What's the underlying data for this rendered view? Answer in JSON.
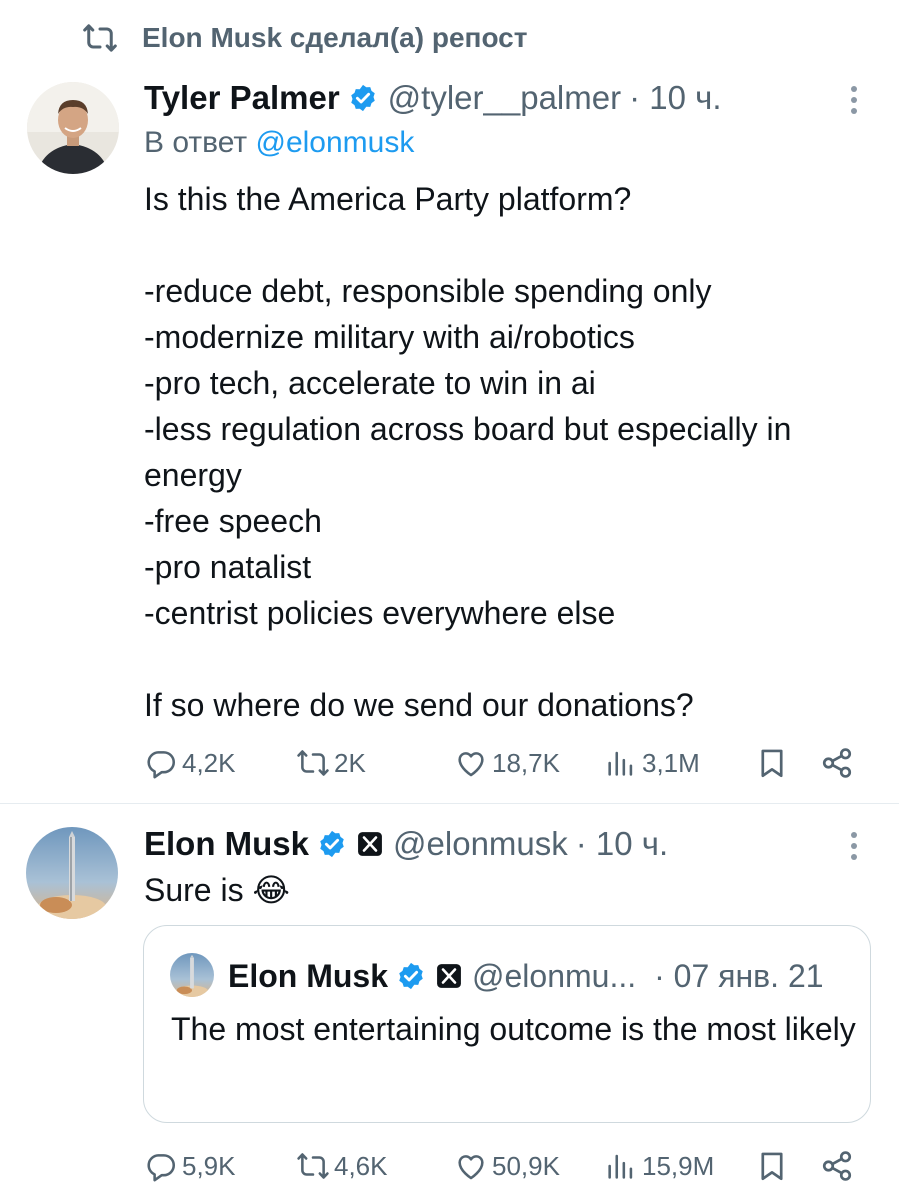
{
  "repost": {
    "text": "Elon Musk сделал(а) репост",
    "icon": "repost-icon"
  },
  "tweet1": {
    "author_name": "Tyler Palmer",
    "handle": "@tyler__palmer",
    "time": "· 10 ч.",
    "reply_prefix": "В ответ",
    "reply_mention": "@elonmusk",
    "text": "Is this the America Party platform?\n\n-reduce debt, responsible spending only\n-modernize military with ai/robotics\n-pro tech, accelerate to win in ai\n-less regulation across board but especially in energy\n-free speech\n-pro natalist\n-centrist policies everywhere else\n\nIf so where do we send our donations?",
    "stats": {
      "replies": "4,2K",
      "reposts": "2K",
      "likes": "18,7K",
      "views": "3,1M"
    }
  },
  "tweet2": {
    "author_name": "Elon Musk",
    "handle": "@elonmusk",
    "time": "· 10 ч.",
    "text": "Sure is 😂",
    "stats": {
      "replies": "5,9K",
      "reposts": "4,6K",
      "likes": "50,9K",
      "views": "15,9M"
    }
  },
  "quoted": {
    "author_name": "Elon Musk",
    "handle": "@elonmu...",
    "time": "· 07 янв. 21",
    "text": "The most entertaining outcome is the most likely"
  },
  "colors": {
    "text": "#0f1419",
    "muted": "#536471",
    "link": "#1d9bf0",
    "verified": "#1d9bf0",
    "border": "#cfd9de"
  }
}
